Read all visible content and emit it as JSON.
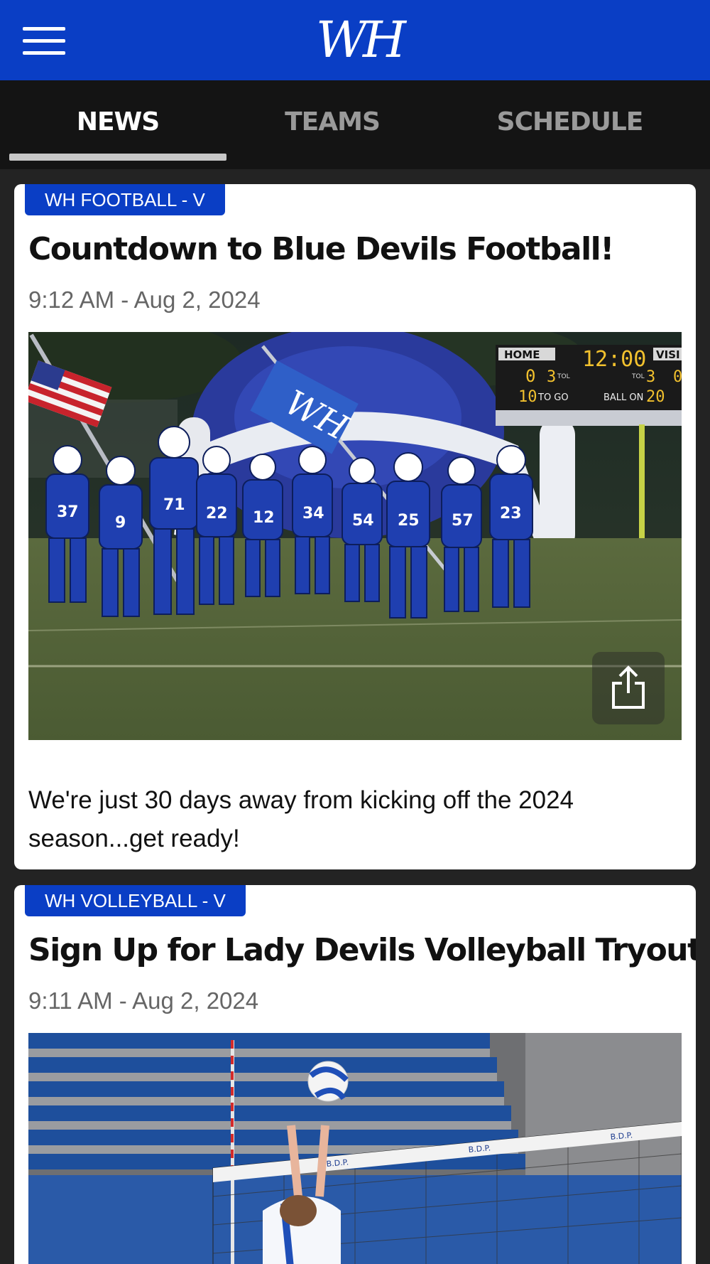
{
  "header": {
    "menu_icon": "hamburger-menu-icon",
    "logo_text": "WH",
    "brand_color": "#0a3ec5"
  },
  "tabs": [
    {
      "label": "NEWS",
      "active": true
    },
    {
      "label": "TEAMS",
      "active": false
    },
    {
      "label": "SCHEDULE",
      "active": false
    }
  ],
  "posts": [
    {
      "team": "WH FOOTBALL - V",
      "title": "Countdown to Blue Devils Football!",
      "time": "9:12 AM - Aug 2, 2024",
      "scoreboard": {
        "home_label": "HOME",
        "visitor_label": "VISI",
        "clock": "12:00",
        "home_score": "0",
        "home_tol": "3",
        "tol_label": "TOL",
        "visitor_tol": "3",
        "to_go": "10",
        "to_go_label": "TO GO",
        "ball_on_label": "BALL ON",
        "ball_on": "20"
      },
      "jersey_numbers": [
        "37",
        "9",
        "71",
        "22",
        "12",
        "34",
        "54",
        "25",
        "57",
        "23"
      ],
      "flag_text": "WH",
      "share_icon": "share-icon",
      "body": "We're just 30 days away from kicking off the 2024 season...get ready!"
    },
    {
      "team": "WH VOLLEYBALL - V",
      "title": "Sign Up for Lady Devils Volleyball Tryouts!",
      "time": "9:11 AM - Aug 2, 2024",
      "net_banner": "B.D.P."
    }
  ]
}
